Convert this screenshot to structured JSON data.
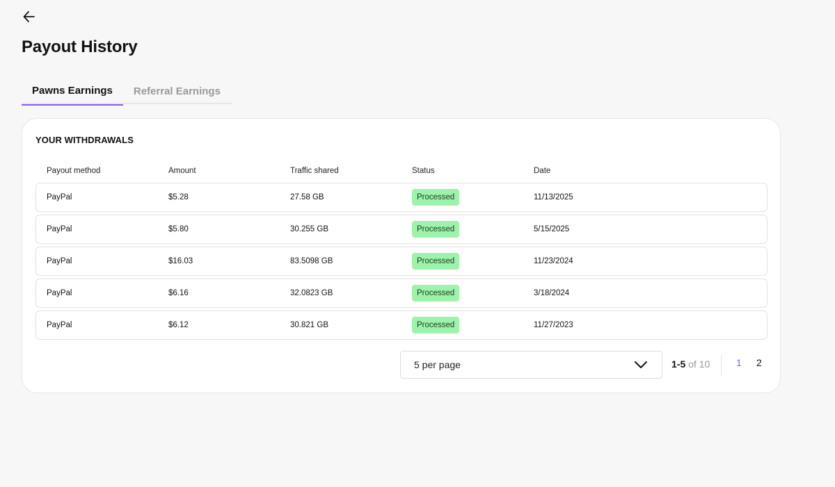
{
  "header": {
    "back_icon": "arrow-left-icon",
    "title": "Payout History"
  },
  "tabs": [
    {
      "label": "Pawns Earnings",
      "active": true
    },
    {
      "label": "Referral Earnings",
      "active": false
    }
  ],
  "withdrawals": {
    "title": "YOUR WITHDRAWALS",
    "columns": [
      "Payout method",
      "Amount",
      "Traffic shared",
      "Status",
      "Date"
    ],
    "rows": [
      {
        "method": "PayPal",
        "amount": "$5.28",
        "traffic": "27.58 GB",
        "status": "Processed",
        "date": "11/13/2025"
      },
      {
        "method": "PayPal",
        "amount": "$5.80",
        "traffic": "30.255 GB",
        "status": "Processed",
        "date": "5/15/2025"
      },
      {
        "method": "PayPal",
        "amount": "$16.03",
        "traffic": "83.5098 GB",
        "status": "Processed",
        "date": "11/23/2024"
      },
      {
        "method": "PayPal",
        "amount": "$6.16",
        "traffic": "32.0823 GB",
        "status": "Processed",
        "date": "3/18/2024"
      },
      {
        "method": "PayPal",
        "amount": "$6.12",
        "traffic": "30.821 GB",
        "status": "Processed",
        "date": "11/27/2023"
      }
    ]
  },
  "pagination": {
    "per_page_label": "5 per page",
    "dropdown_icon": "chevron-down-icon",
    "range": "1-5",
    "of_label": "of",
    "total": "10",
    "pages": [
      "1",
      "2"
    ],
    "current_page": "1"
  },
  "colors": {
    "accent": "#8a5cf0",
    "status_processed_bg": "#9df3a9",
    "background": "#f7f7f7"
  }
}
